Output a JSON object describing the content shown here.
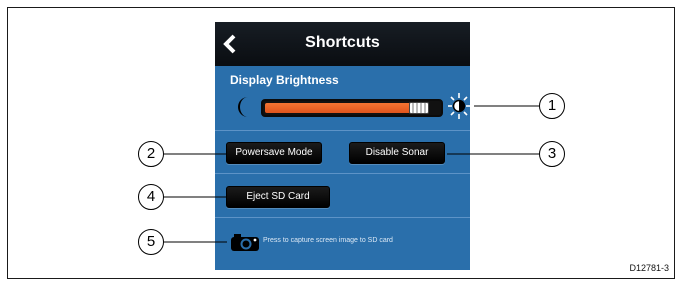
{
  "header": {
    "title": "Shortcuts",
    "back_icon": "chevron-left-icon"
  },
  "display_brightness": {
    "label": "Display Brightness",
    "level": 0.9,
    "min_icon": "moon-icon",
    "max_icon": "sun-icon",
    "fill_color": "#f26522"
  },
  "buttons": {
    "powersave": "Powersave Mode",
    "disable_sonar": "Disable Sonar",
    "eject_sd": "Eject SD Card"
  },
  "capture": {
    "text": "Press to capture screen image to SD card",
    "icon": "camera-icon"
  },
  "callouts": [
    "1",
    "2",
    "3",
    "4",
    "5"
  ],
  "drawing_code": "D12781-3",
  "colors": {
    "panel_blue": "#2a6fab",
    "title_bar": "#10151b",
    "button": "#0d0d0d"
  }
}
